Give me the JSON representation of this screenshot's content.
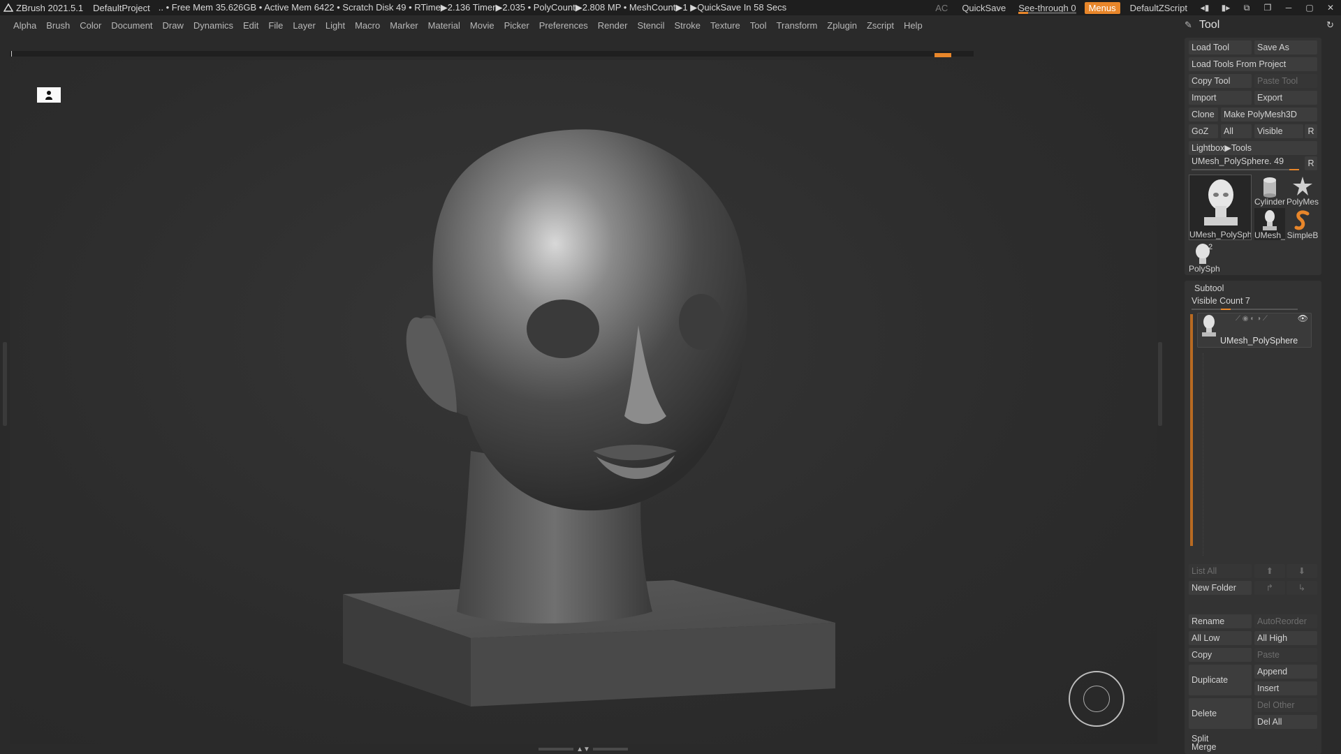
{
  "titlebar": {
    "app": "ZBrush 2021.5.1",
    "project": "DefaultProject",
    "status": ".. • Free Mem 35.626GB • Active Mem 6422 • Scratch Disk 49 •  RTime▶2.136 Timer▶2.035 • PolyCount▶2.808 MP  • MeshCount▶1  ▶QuickSave In 58 Secs",
    "ac": "AC",
    "quicksave": "QuickSave",
    "seethrough": "See-through   0",
    "menus": "Menus",
    "script": "DefaultZScript"
  },
  "menubar": [
    "Alpha",
    "Brush",
    "Color",
    "Document",
    "Draw",
    "Dynamics",
    "Edit",
    "File",
    "Layer",
    "Light",
    "Macro",
    "Marker",
    "Material",
    "Movie",
    "Picker",
    "Preferences",
    "Render",
    "Stencil",
    "Stroke",
    "Texture",
    "Tool",
    "Transform",
    "Zplugin",
    "Zscript",
    "Help"
  ],
  "panel": {
    "title": "Tool",
    "load_tool": "Load Tool",
    "save_as": "Save As",
    "load_from_project": "Load Tools From Project",
    "copy_tool": "Copy Tool",
    "paste_tool": "Paste Tool",
    "import": "Import",
    "export": "Export",
    "clone": "Clone",
    "make_polymesh": "Make PolyMesh3D",
    "goz": "GoZ",
    "all": "All",
    "visible": "Visible",
    "r": "R",
    "lightbox": "Lightbox▶Tools",
    "current_tool": "UMesh_PolySphere. 49",
    "thumbs": [
      {
        "label": "UMesh_PolySphe",
        "icon": "head-icon"
      },
      {
        "label": "Cylinder",
        "icon": "cylinder-icon"
      },
      {
        "label": "PolyMes",
        "icon": "star-icon"
      },
      {
        "label": "UMesh_",
        "icon": "head-icon"
      },
      {
        "label": "SimpleB",
        "icon": "brush-s-icon"
      },
      {
        "label": "PolySph",
        "icon": "head-icon",
        "badge": "2"
      }
    ],
    "subtool": {
      "title": "Subtool",
      "visible_count": "Visible Count 7",
      "item": "UMesh_PolySphere",
      "list_all": "List All",
      "new_folder": "New Folder",
      "rename": "Rename",
      "autoreorder": "AutoReorder",
      "all_low": "All Low",
      "all_high": "All High",
      "copy": "Copy",
      "paste": "Paste",
      "duplicate": "Duplicate",
      "append": "Append",
      "insert": "Insert",
      "delete": "Delete",
      "del_other": "Del Other",
      "del_all": "Del All",
      "split": "Split",
      "merge": "Merge"
    }
  },
  "colors": {
    "accent": "#e8862a",
    "background": "#2a2a2a",
    "panel": "#333333"
  }
}
